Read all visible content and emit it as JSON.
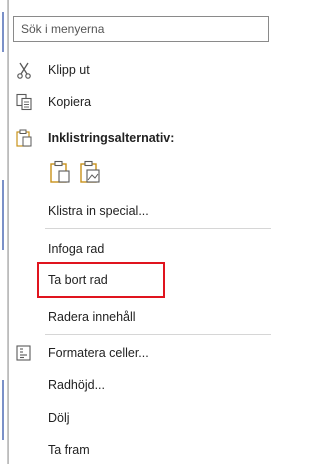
{
  "search": {
    "placeholder": "Sök i menyerna"
  },
  "menu": {
    "cut": "Klipp ut",
    "copy": "Kopiera",
    "paste_options": "Inklistringsalternativ:",
    "paste_special": "Klistra in special...",
    "insert_row": "Infoga rad",
    "delete_row": "Ta bort rad",
    "clear_contents": "Radera innehåll",
    "format_cells": "Formatera celler...",
    "row_height": "Radhöjd...",
    "hide": "Dölj",
    "unhide": "Ta fram"
  },
  "colors": {
    "highlight_border": "#e0141e",
    "icon_gold": "#c9921a",
    "icon_gray": "#5a5a5a"
  },
  "icons": [
    "scissors-icon",
    "copy-icon",
    "clipboard-icon",
    "paste-icon",
    "paste-picture-icon",
    "format-cells-icon"
  ]
}
